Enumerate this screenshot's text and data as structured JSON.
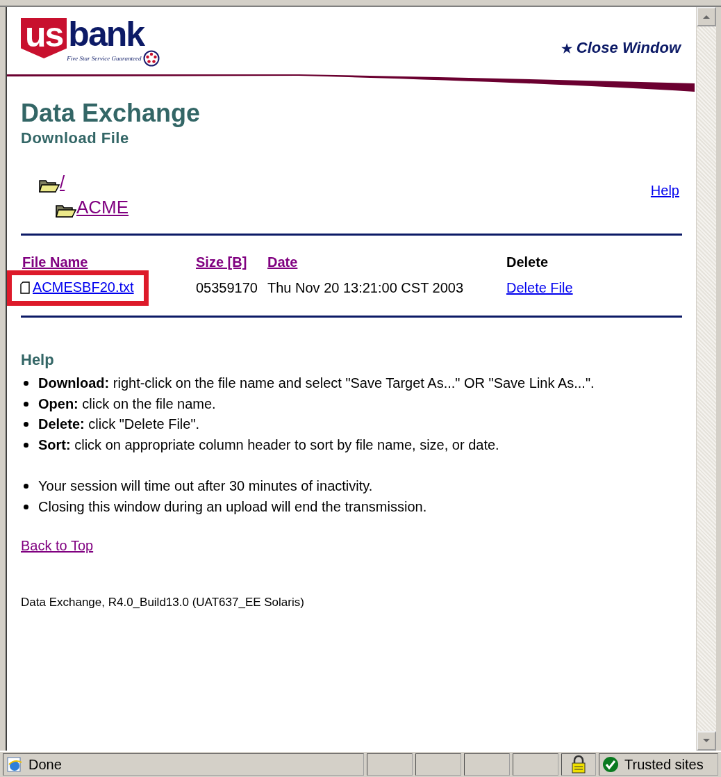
{
  "header": {
    "logo_us": "us",
    "logo_bank": "bank",
    "logo_tagline": "Five Star Service Guaranteed",
    "close_icon": "★",
    "close_window": "Close Window"
  },
  "title": "Data Exchange",
  "subtitle": "Download File",
  "folders": [
    {
      "label": "/",
      "visited": true,
      "children": [
        {
          "label": "ACME",
          "visited": true
        }
      ]
    }
  ],
  "help_link": {
    "label": "Help",
    "visited": false
  },
  "table": {
    "columns": [
      {
        "label": "File Name",
        "link": true
      },
      {
        "label": "Size [B]",
        "link": true
      },
      {
        "label": "Date",
        "link": true
      },
      {
        "label": "Delete",
        "link": false
      }
    ],
    "rows": [
      {
        "file_name": "ACMESBF20.txt",
        "size": "05359170",
        "date": "Thu Nov 20 13:21:00 CST 2003",
        "action": "Delete File",
        "highlighted": true
      }
    ]
  },
  "help": {
    "heading": "Help",
    "items": [
      "**Download:** right-click on the file name and select \"Save Target As...\" OR \"Save Link As...\".",
      "**Open:** click on the file name.",
      "**Delete:** click \"Delete File\".",
      "**Sort:** click on appropriate column header to sort by file name, size, or date."
    ],
    "notes": [
      "Your session will time out after 30 minutes of inactivity.",
      "Closing this window during an upload will end the transmission."
    ]
  },
  "back_to_top": {
    "label": "Back to Top",
    "visited": true
  },
  "version": "Data Exchange, R4.0_Build13.0 (UAT637_EE Solaris)",
  "status_bar": {
    "status": "Done",
    "zone": "Trusted sites"
  }
}
